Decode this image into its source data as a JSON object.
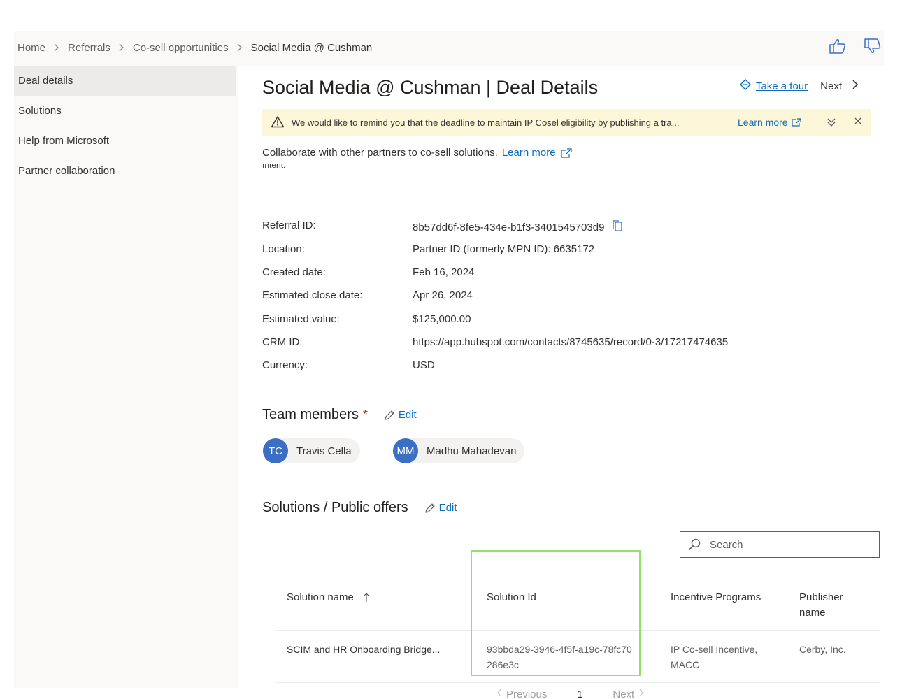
{
  "breadcrumb": [
    "Home",
    "Referrals",
    "Co-sell opportunities",
    "Social Media @ Cushman"
  ],
  "sidebar": {
    "items": [
      {
        "label": "Deal details"
      },
      {
        "label": "Solutions"
      },
      {
        "label": "Help from Microsoft"
      },
      {
        "label": "Partner collaboration"
      }
    ]
  },
  "header": {
    "title": "Social Media @ Cushman | Deal Details",
    "take_tour": "Take a tour",
    "next": "Next"
  },
  "banner": {
    "message": "We would like to remind you that the deadline to maintain IP Cosel eligibility by publishing a tra...",
    "learn_more": "Learn more"
  },
  "collab": {
    "text": "Collaborate with other partners to co-sell solutions.",
    "learn_more": "Learn more"
  },
  "partial_label": "Intent:",
  "details": [
    {
      "label": "Referral ID:",
      "value": "8b57dd6f-8fe5-434e-b1f3-3401545703d9"
    },
    {
      "label": "Location:",
      "value": "Partner ID (formerly MPN ID): 6635172"
    },
    {
      "label": "Created date:",
      "value": "Feb 16, 2024"
    },
    {
      "label": "Estimated close date:",
      "value": "Apr 26, 2024"
    },
    {
      "label": "Estimated value:",
      "value": "$125,000.00"
    },
    {
      "label": "CRM ID:",
      "value": "https://app.hubspot.com/contacts/8745635/record/0-3/17217474635"
    },
    {
      "label": "Currency:",
      "value": "USD"
    }
  ],
  "team": {
    "title": "Team members",
    "required_mark": "*",
    "edit": "Edit",
    "members": [
      {
        "initials": "TC",
        "name": "Travis Cella"
      },
      {
        "initials": "MM",
        "name": "Madhu Mahadevan"
      }
    ]
  },
  "solutions": {
    "title": "Solutions / Public offers",
    "edit": "Edit",
    "search_placeholder": "Search",
    "columns": [
      "Solution name",
      "Solution Id",
      "Incentive Programs",
      "Publisher name"
    ],
    "rows": [
      {
        "name": "SCIM and HR Onboarding Bridge...",
        "id": "93bbda29-3946-4f5f-a19c-78fc70286e3c",
        "programs": "IP Co-sell Incentive, MACC",
        "publisher": "Cerby, Inc."
      }
    ],
    "pager": {
      "previous": "Previous",
      "page": "1",
      "next": "Next"
    }
  },
  "colors": {
    "accent": "#0f6cbd",
    "avatar": "#3a6fc4",
    "banner_bg": "#fdf6d8",
    "highlight": "#92e26a",
    "required": "#c50f1f"
  }
}
